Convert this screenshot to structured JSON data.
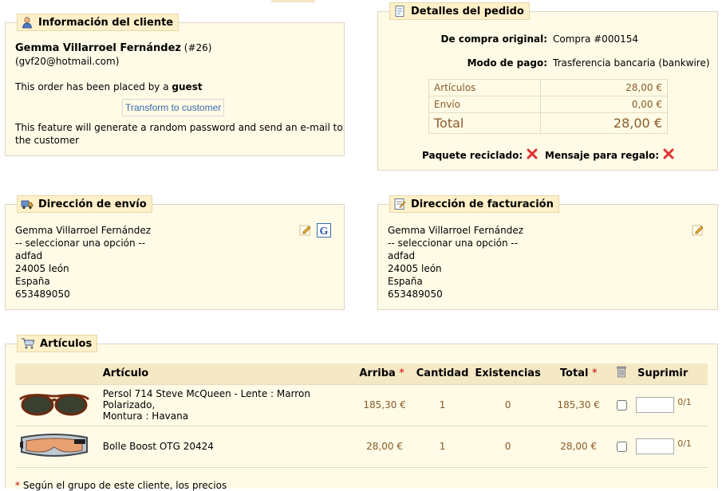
{
  "customer_panel": {
    "title": "Información del cliente",
    "customer_name": "Gemma Villarroel Fernández",
    "customer_id": "(#26)",
    "email": "(gvf20@hotmail.com)",
    "guest_text": "This order has been placed by a",
    "guest_word": "guest",
    "transform_button": "Transform to customer",
    "feature_line1": "This feature will generate a random password and send an e-mail to",
    "feature_line2": "the customer"
  },
  "order_panel": {
    "title": "Detalles del pedido",
    "original_label": "De compra original:",
    "original_value": "Compra #000154",
    "payment_label": "Modo de pago:",
    "payment_value": "Trasferencia bancaria (bankwire)",
    "totals": [
      {
        "label": "Artículos",
        "value": "28,00 €"
      },
      {
        "label": "Envío",
        "value": "0,00 €"
      },
      {
        "label": "Total",
        "value": "28,00 €"
      }
    ],
    "recycled_label": "Paquete reciclado:",
    "gift_label": "Mensaje para regalo:"
  },
  "shipping_panel": {
    "title": "Dirección de envío",
    "lines": [
      "Gemma Villarroel Fernández",
      "-- seleccionar una opción --",
      "adfad",
      "24005 león",
      "España",
      "653489050"
    ]
  },
  "billing_panel": {
    "title": "Dirección de facturación",
    "lines": [
      "Gemma Villarroel Fernández",
      "-- seleccionar una opción --",
      "adfad",
      "24005 león",
      "España",
      "653489050"
    ]
  },
  "articles_panel": {
    "title": "Artículos",
    "headers": {
      "article": "Artículo",
      "price": "Arriba",
      "quantity": "Cantidad",
      "stock": "Existencias",
      "total": "Total",
      "delete": "Suprimir",
      "star": "*"
    },
    "rows": [
      {
        "name_line1": "Persol 714 Steve McQueen - Lente : Marron Polarizado,",
        "name_line2": "Montura : Havana",
        "price": "185,30 €",
        "quantity": "1",
        "stock": "0",
        "total": "185,30 €",
        "qty_suffix": "0/1",
        "image": "sunglasses"
      },
      {
        "name_line1": "Bolle Boost OTG 20424",
        "name_line2": "",
        "price": "28,00 €",
        "quantity": "1",
        "stock": "0",
        "total": "28,00 €",
        "qty_suffix": "0/1",
        "image": "ski-goggles"
      }
    ],
    "footnote_star": "*",
    "footnote": "Según el grupo de este cliente, los precios"
  },
  "icons": {
    "customer": "person-icon",
    "order": "document-icon",
    "shipping": "truck-icon",
    "billing": "invoice-icon",
    "articles": "cart-icon",
    "edit": "pencil-icon",
    "google": "google-maps-icon",
    "no": "red-x-icon",
    "trash": "trash-icon"
  },
  "colors": {
    "panel_bg": "#fffbe6",
    "legend_bg": "#fff0c9",
    "price_text": "#8a5a2a",
    "link_blue": "#3a6bb0",
    "red": "#cc0000"
  }
}
